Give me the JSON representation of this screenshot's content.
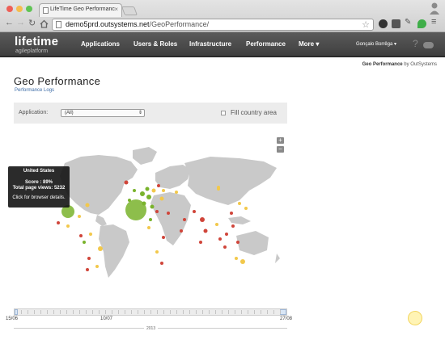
{
  "browser": {
    "tab_title": "LifeTime Geo Performanc",
    "url_host": "demo5prd.outsystems.net",
    "url_path": "/GeoPerformance/"
  },
  "header": {
    "logo_main": "lifetime",
    "logo_sub": "agileplatform",
    "menu": [
      "Applications",
      "Users & Roles",
      "Infrastructure",
      "Performance",
      "More ▾"
    ],
    "user": "Gonçalo Borrêga ▾",
    "help": "?"
  },
  "page": {
    "breadcrumb_main": "Geo Performance",
    "breadcrumb_sub": " by OutSystems",
    "title": "Geo Performance",
    "sublink": "Performance Logs"
  },
  "filters": {
    "application_label": "Application:",
    "application_value": "(All)",
    "fill_country_label": "Fill country area",
    "fill_country_checked": false
  },
  "map": {
    "zoom_in": "+",
    "zoom_out": "−",
    "colors": {
      "good": "#79b32c",
      "medium": "#f2c84b",
      "bad": "#d0453a",
      "land": "#c9c9c9"
    },
    "tooltip": {
      "country": "United States",
      "score": "Score : 89%",
      "views": "Total page views: 5232",
      "hint": "Click for browser details."
    }
  },
  "timeline": {
    "start": "15/06",
    "middle": "10/07",
    "end": "27/08",
    "year": "2013"
  }
}
